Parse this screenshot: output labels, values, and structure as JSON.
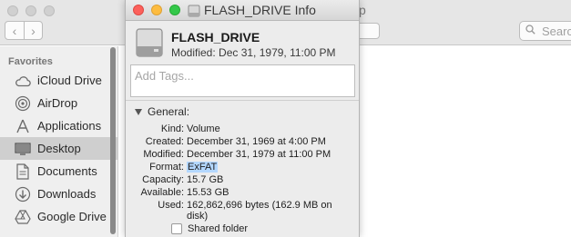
{
  "finder": {
    "title_fragment": "p",
    "search_placeholder": "Search",
    "sidebar": {
      "heading": "Favorites",
      "items": [
        {
          "label": "iCloud Drive",
          "icon": "cloud-icon"
        },
        {
          "label": "AirDrop",
          "icon": "airdrop-icon"
        },
        {
          "label": "Applications",
          "icon": "applications-icon"
        },
        {
          "label": "Desktop",
          "icon": "desktop-icon",
          "selected": true
        },
        {
          "label": "Documents",
          "icon": "documents-icon"
        },
        {
          "label": "Downloads",
          "icon": "downloads-icon"
        },
        {
          "label": "Google Drive",
          "icon": "google-drive-icon"
        }
      ]
    }
  },
  "info": {
    "title": "FLASH_DRIVE Info",
    "name": "FLASH_DRIVE",
    "modified": "Modified: Dec 31, 1979, 11:00 PM",
    "tags_placeholder": "Add Tags...",
    "general_label": "General:",
    "fields": [
      {
        "key": "Kind:",
        "value": "Volume"
      },
      {
        "key": "Created:",
        "value": "December 31, 1969 at 4:00 PM"
      },
      {
        "key": "Modified:",
        "value": "December 31, 1979 at 11:00 PM"
      },
      {
        "key": "Format:",
        "value": "ExFAT"
      },
      {
        "key": "Capacity:",
        "value": "15.7 GB"
      },
      {
        "key": "Available:",
        "value": "15.53 GB"
      },
      {
        "key": "Used:",
        "value": "162,862,696 bytes (162.9 MB on"
      },
      {
        "key": "",
        "value": "disk)"
      }
    ],
    "shared_folder_label": "Shared folder",
    "shared_folder_checked": false
  },
  "colors": {
    "close": "#fc605b",
    "minimize": "#fdbc40",
    "zoom": "#34c84a",
    "selection_highlight": "#b3d7ff",
    "sidebar_selected": "#cfcfcf"
  }
}
